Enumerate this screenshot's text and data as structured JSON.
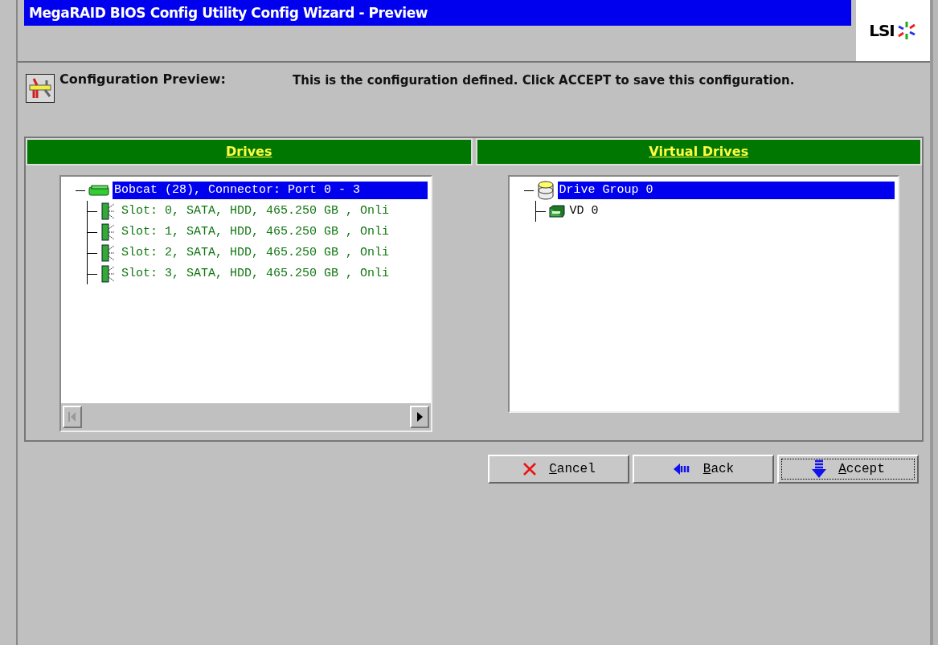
{
  "window": {
    "title": "MegaRAID BIOS Config Utility Config Wizard - Preview",
    "logo": "LSI"
  },
  "header": {
    "label": "Configuration Preview:",
    "message": "This is the configuration defined. Click ACCEPT to save this configuration."
  },
  "panels": [
    {
      "title": "Drives",
      "horizontal_scrollbar": true,
      "tree": [
        {
          "kind": "controller",
          "label": "Bobcat (28), Connector: Port 0 - 3",
          "selected": true,
          "children": [
            {
              "kind": "drive",
              "label": "Slot: 0, SATA, HDD, 465.250 GB , Onli",
              "selected": false
            },
            {
              "kind": "drive",
              "label": "Slot: 1, SATA, HDD, 465.250 GB , Onli",
              "selected": false
            },
            {
              "kind": "drive",
              "label": "Slot: 2, SATA, HDD, 465.250 GB , Onli",
              "selected": false
            },
            {
              "kind": "drive",
              "label": "Slot: 3, SATA, HDD, 465.250 GB , Onli",
              "selected": false
            }
          ]
        }
      ]
    },
    {
      "title": "Virtual Drives",
      "tree": [
        {
          "kind": "drive_group",
          "label": "Drive Group 0",
          "selected": true,
          "children": [
            {
              "kind": "virtual_drive",
              "label": "VD 0",
              "selected": false
            }
          ]
        }
      ]
    }
  ],
  "buttons": [
    {
      "kind": "cancel",
      "label": "Cancel",
      "focused": false
    },
    {
      "kind": "back",
      "label": "Back",
      "focused": false
    },
    {
      "kind": "accept",
      "label": "Accept",
      "focused": true
    }
  ]
}
